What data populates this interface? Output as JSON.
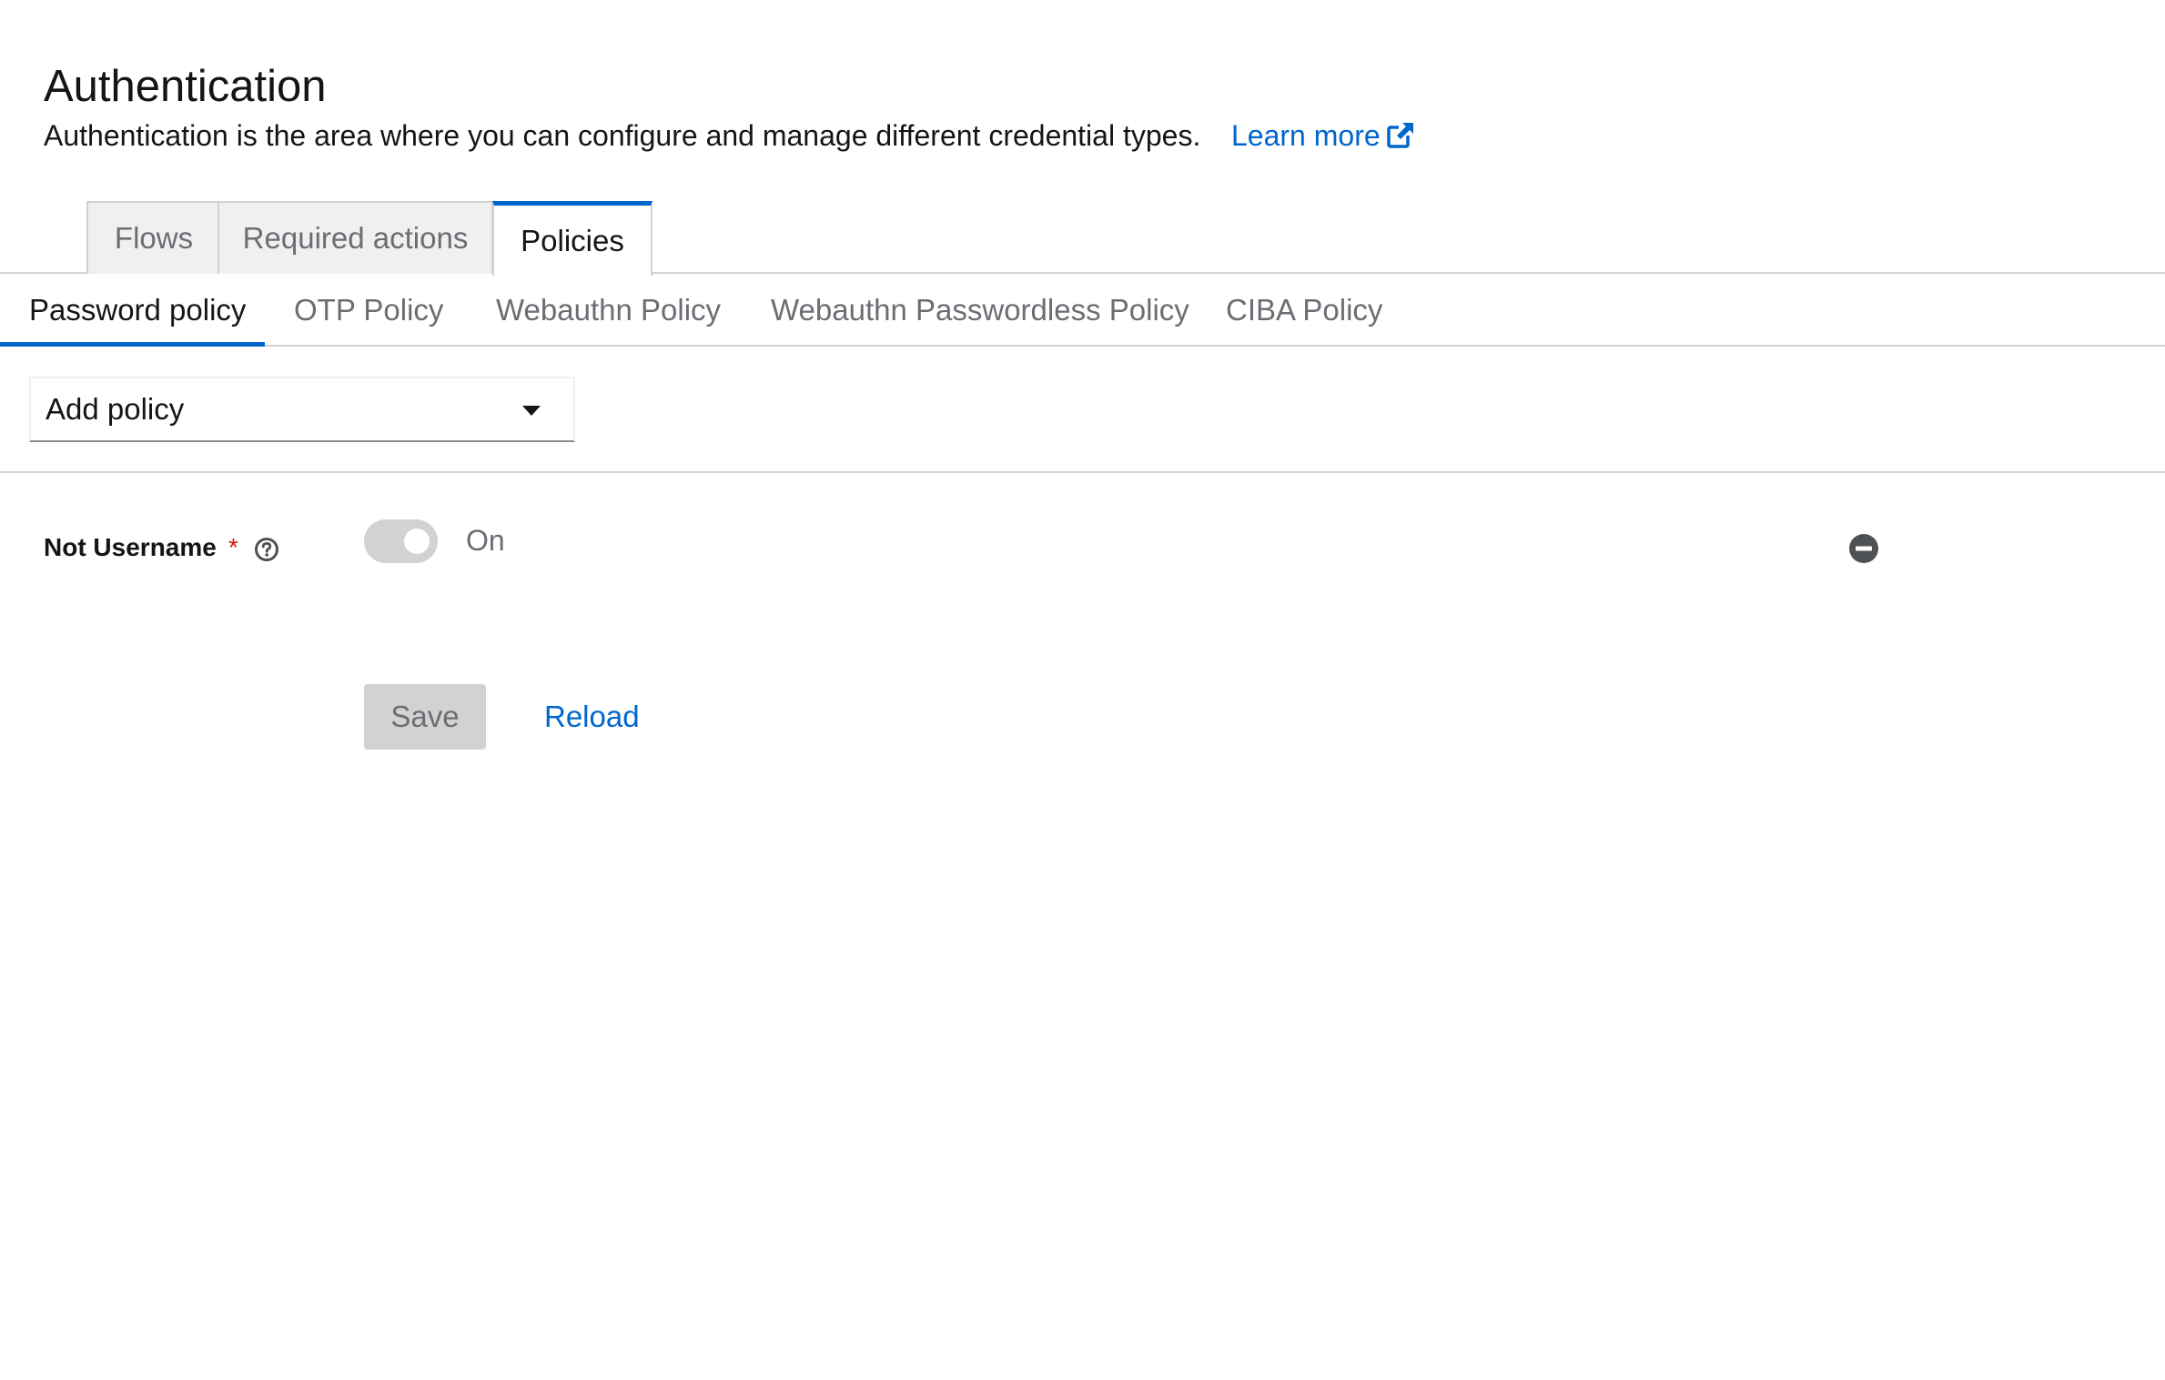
{
  "header": {
    "title": "Authentication",
    "description": "Authentication is the area where you can configure and manage different credential types.",
    "learn_more": "Learn more"
  },
  "top_tabs": [
    {
      "label": "Flows",
      "active": false
    },
    {
      "label": "Required actions",
      "active": false
    },
    {
      "label": "Policies",
      "active": true
    }
  ],
  "sub_tabs": [
    {
      "label": "Password policy",
      "active": true
    },
    {
      "label": "OTP Policy",
      "active": false
    },
    {
      "label": "Webauthn Policy",
      "active": false
    },
    {
      "label": "Webauthn Passwordless Policy",
      "active": false
    },
    {
      "label": "CIBA Policy",
      "active": false
    }
  ],
  "add_policy": {
    "label": "Add policy",
    "icon": "caret-down-icon"
  },
  "policy_row": {
    "label": "Not Username",
    "required_marker": "*",
    "help_icon": "question-circle-icon",
    "toggle_state": "On",
    "toggle_on": true,
    "remove_icon": "minus-circle-icon"
  },
  "actions": {
    "save": "Save",
    "reload": "Reload"
  },
  "colors": {
    "accent": "#0066cc",
    "required": "#c9190b",
    "disabled_bg": "#d2d2d2",
    "muted_text": "#6a6e73"
  }
}
